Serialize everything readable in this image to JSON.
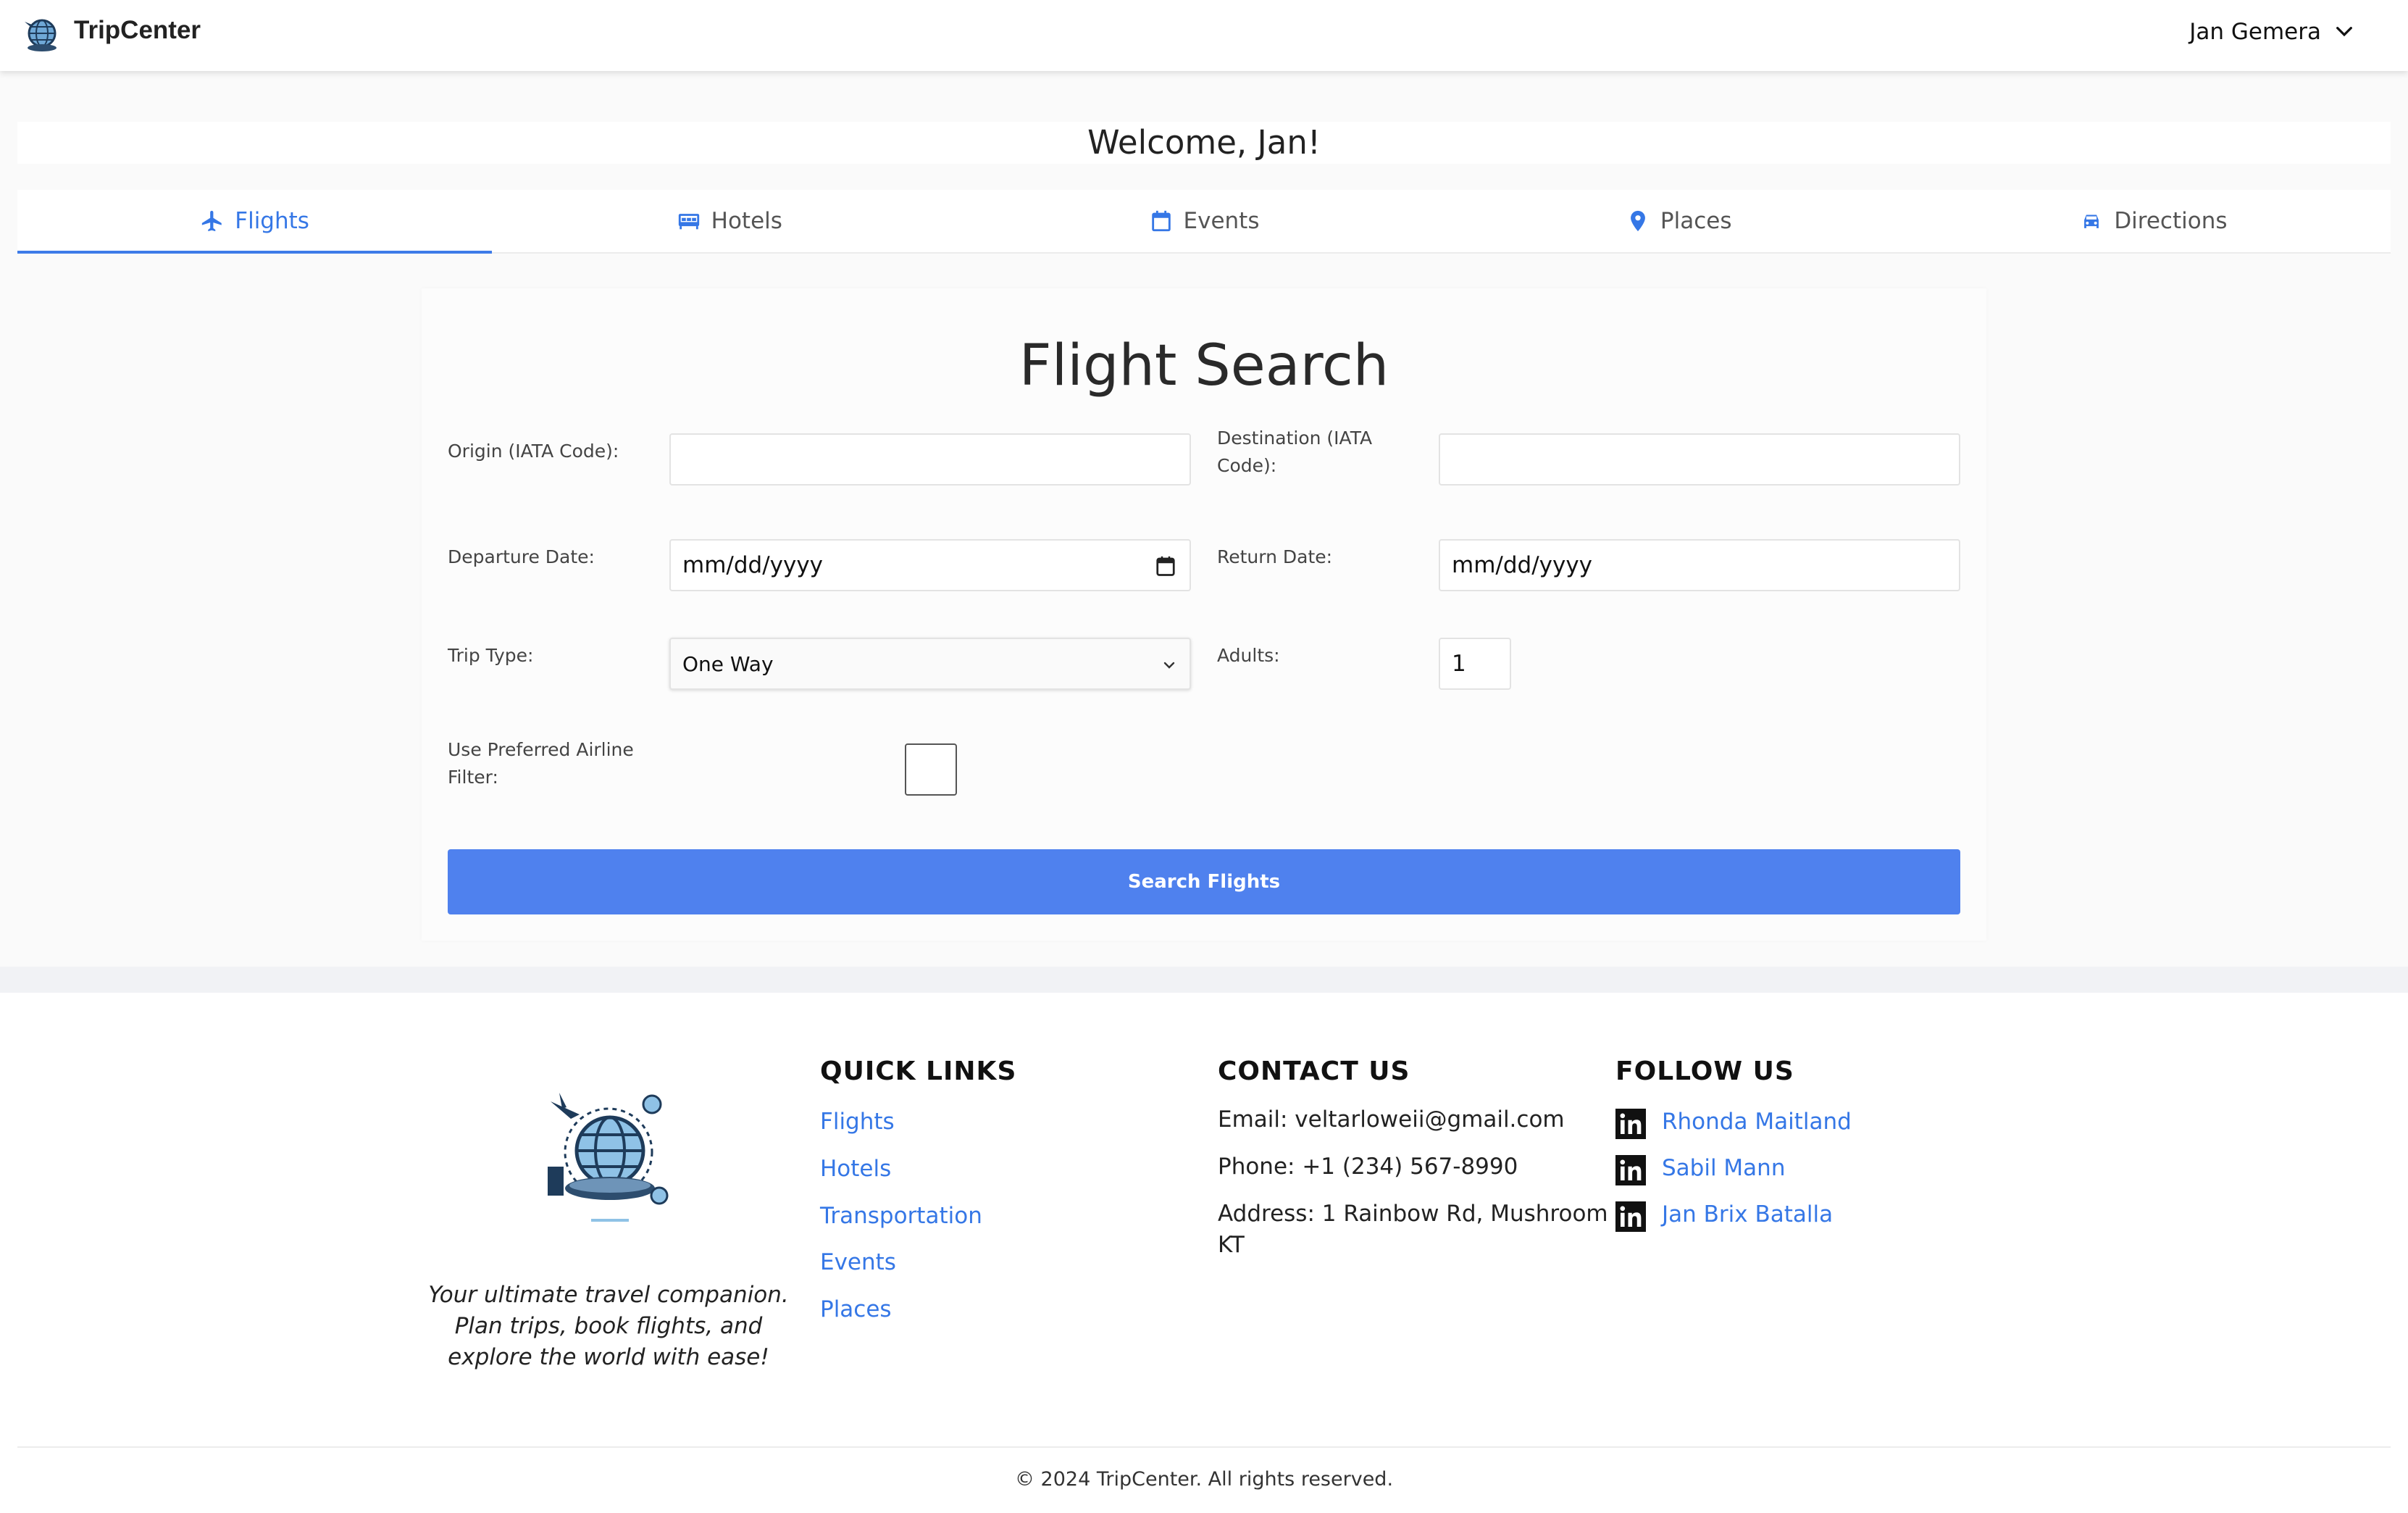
{
  "header": {
    "brand": "TripCenter",
    "user_name": "Jan Gemera"
  },
  "welcome": "Welcome, Jan!",
  "tabs": [
    {
      "label": "Flights",
      "icon": "airplane-icon",
      "active": true
    },
    {
      "label": "Hotels",
      "icon": "hotel-icon",
      "active": false
    },
    {
      "label": "Events",
      "icon": "calendar-icon",
      "active": false
    },
    {
      "label": "Places",
      "icon": "map-pin-icon",
      "active": false
    },
    {
      "label": "Directions",
      "icon": "car-icon",
      "active": false
    }
  ],
  "form": {
    "title": "Flight Search",
    "origin_label": "Origin (IATA Code):",
    "origin_value": "",
    "destination_label_1": "Destination (IATA",
    "destination_label_2": "Code):",
    "destination_value": "",
    "departure_label": "Departure Date:",
    "departure_value": "mm/dd/yyyy",
    "return_label": "Return Date:",
    "return_value": "mm/dd/yyyy",
    "trip_type_label": "Trip Type:",
    "trip_type_value": "One Way",
    "adults_label": "Adults:",
    "adults_value": "1",
    "preferred_label_1": "Use Preferred Airline",
    "preferred_label_2": "Filter:",
    "preferred_checked": false,
    "search_button": "Search Flights"
  },
  "footer": {
    "tagline_1": "Your ultimate travel companion.",
    "tagline_2": "Plan trips, book flights, and",
    "tagline_3": "explore the world with ease!",
    "quick_links_title": "QUICK LINKS",
    "quick_links": [
      "Flights",
      "Hotels",
      "Transportation",
      "Events",
      "Places"
    ],
    "contact_title": "CONTACT US",
    "email": "Email: veltarloweii@gmail.com",
    "phone": "Phone: +1 (234) 567-8990",
    "address_1": "Address: 1 Rainbow Rd, Mushroom",
    "address_2": "KT",
    "follow_title": "FOLLOW US",
    "follow_links": [
      "Rhonda Maitland",
      "Sabil Mann",
      "Jan Brix Batalla"
    ],
    "copyright": "© 2024 TripCenter. All rights reserved."
  },
  "colors": {
    "accent": "#3577e6",
    "button": "#4f81ee"
  }
}
